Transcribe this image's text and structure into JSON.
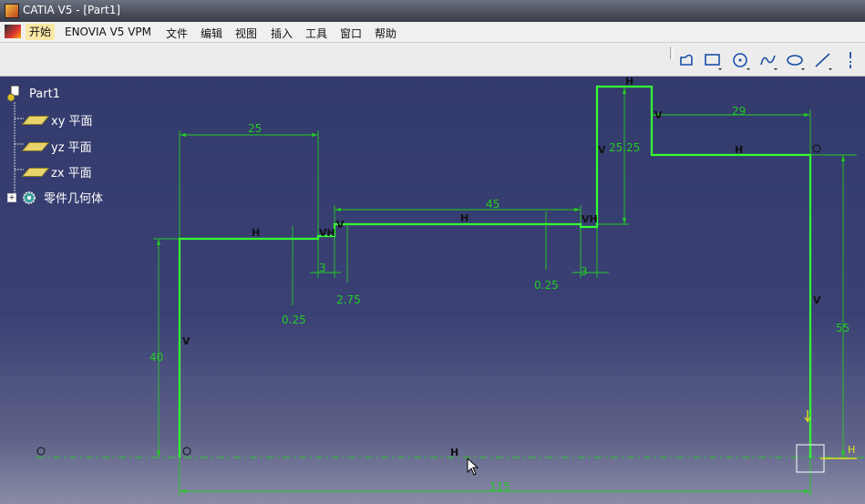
{
  "window": {
    "title": "CATIA V5 - [Part1]"
  },
  "menu": {
    "items": [
      "开始",
      "ENOVIA V5 VPM",
      "文件",
      "编辑",
      "视图",
      "插入",
      "工具",
      "窗口",
      "帮助"
    ]
  },
  "toolbar": {
    "tools": [
      "profile-icon",
      "rectangle-icon",
      "circle-icon",
      "spline-icon",
      "ellipse-icon",
      "line-icon",
      "axis-icon"
    ]
  },
  "tree": {
    "root": "Part1",
    "children": [
      "xy 平面",
      "yz 平面",
      "zx 平面",
      "零件几何体"
    ]
  },
  "sketch": {
    "dimensions": [
      "25",
      "45",
      "29",
      "25.25",
      "3",
      "2.75",
      "0.25",
      "3",
      "0.25",
      "40",
      "55",
      "115"
    ],
    "constraint_h": "H",
    "constraint_v": "V",
    "constraint_vh": "VH"
  },
  "colors": {
    "sketch": "#22ee22",
    "dimension": "#22cc22",
    "canvas_top": "#333a6c",
    "canvas_bottom": "#8a8ca6"
  }
}
